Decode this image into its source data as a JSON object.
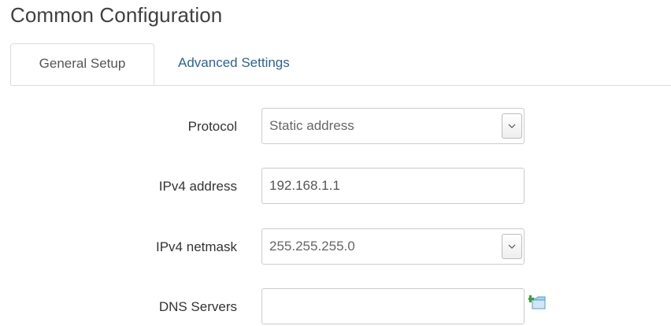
{
  "section": {
    "title": "Common Configuration"
  },
  "tabs": [
    {
      "label": "General Setup",
      "active": true
    },
    {
      "label": "Advanced Settings",
      "active": false
    }
  ],
  "form": {
    "protocol": {
      "label": "Protocol",
      "value": "Static address"
    },
    "ipv4_address": {
      "label": "IPv4 address",
      "value": "192.168.1.1"
    },
    "ipv4_netmask": {
      "label": "IPv4 netmask",
      "value": "255.255.255.0"
    },
    "dns_servers": {
      "label": "DNS Servers",
      "value": ""
    }
  },
  "icons": {
    "dropdown": "chevron-down-icon",
    "add": "add-entry-icon"
  },
  "colors": {
    "link": "#2a6496",
    "border": "#cccccc",
    "title": "#404040"
  }
}
